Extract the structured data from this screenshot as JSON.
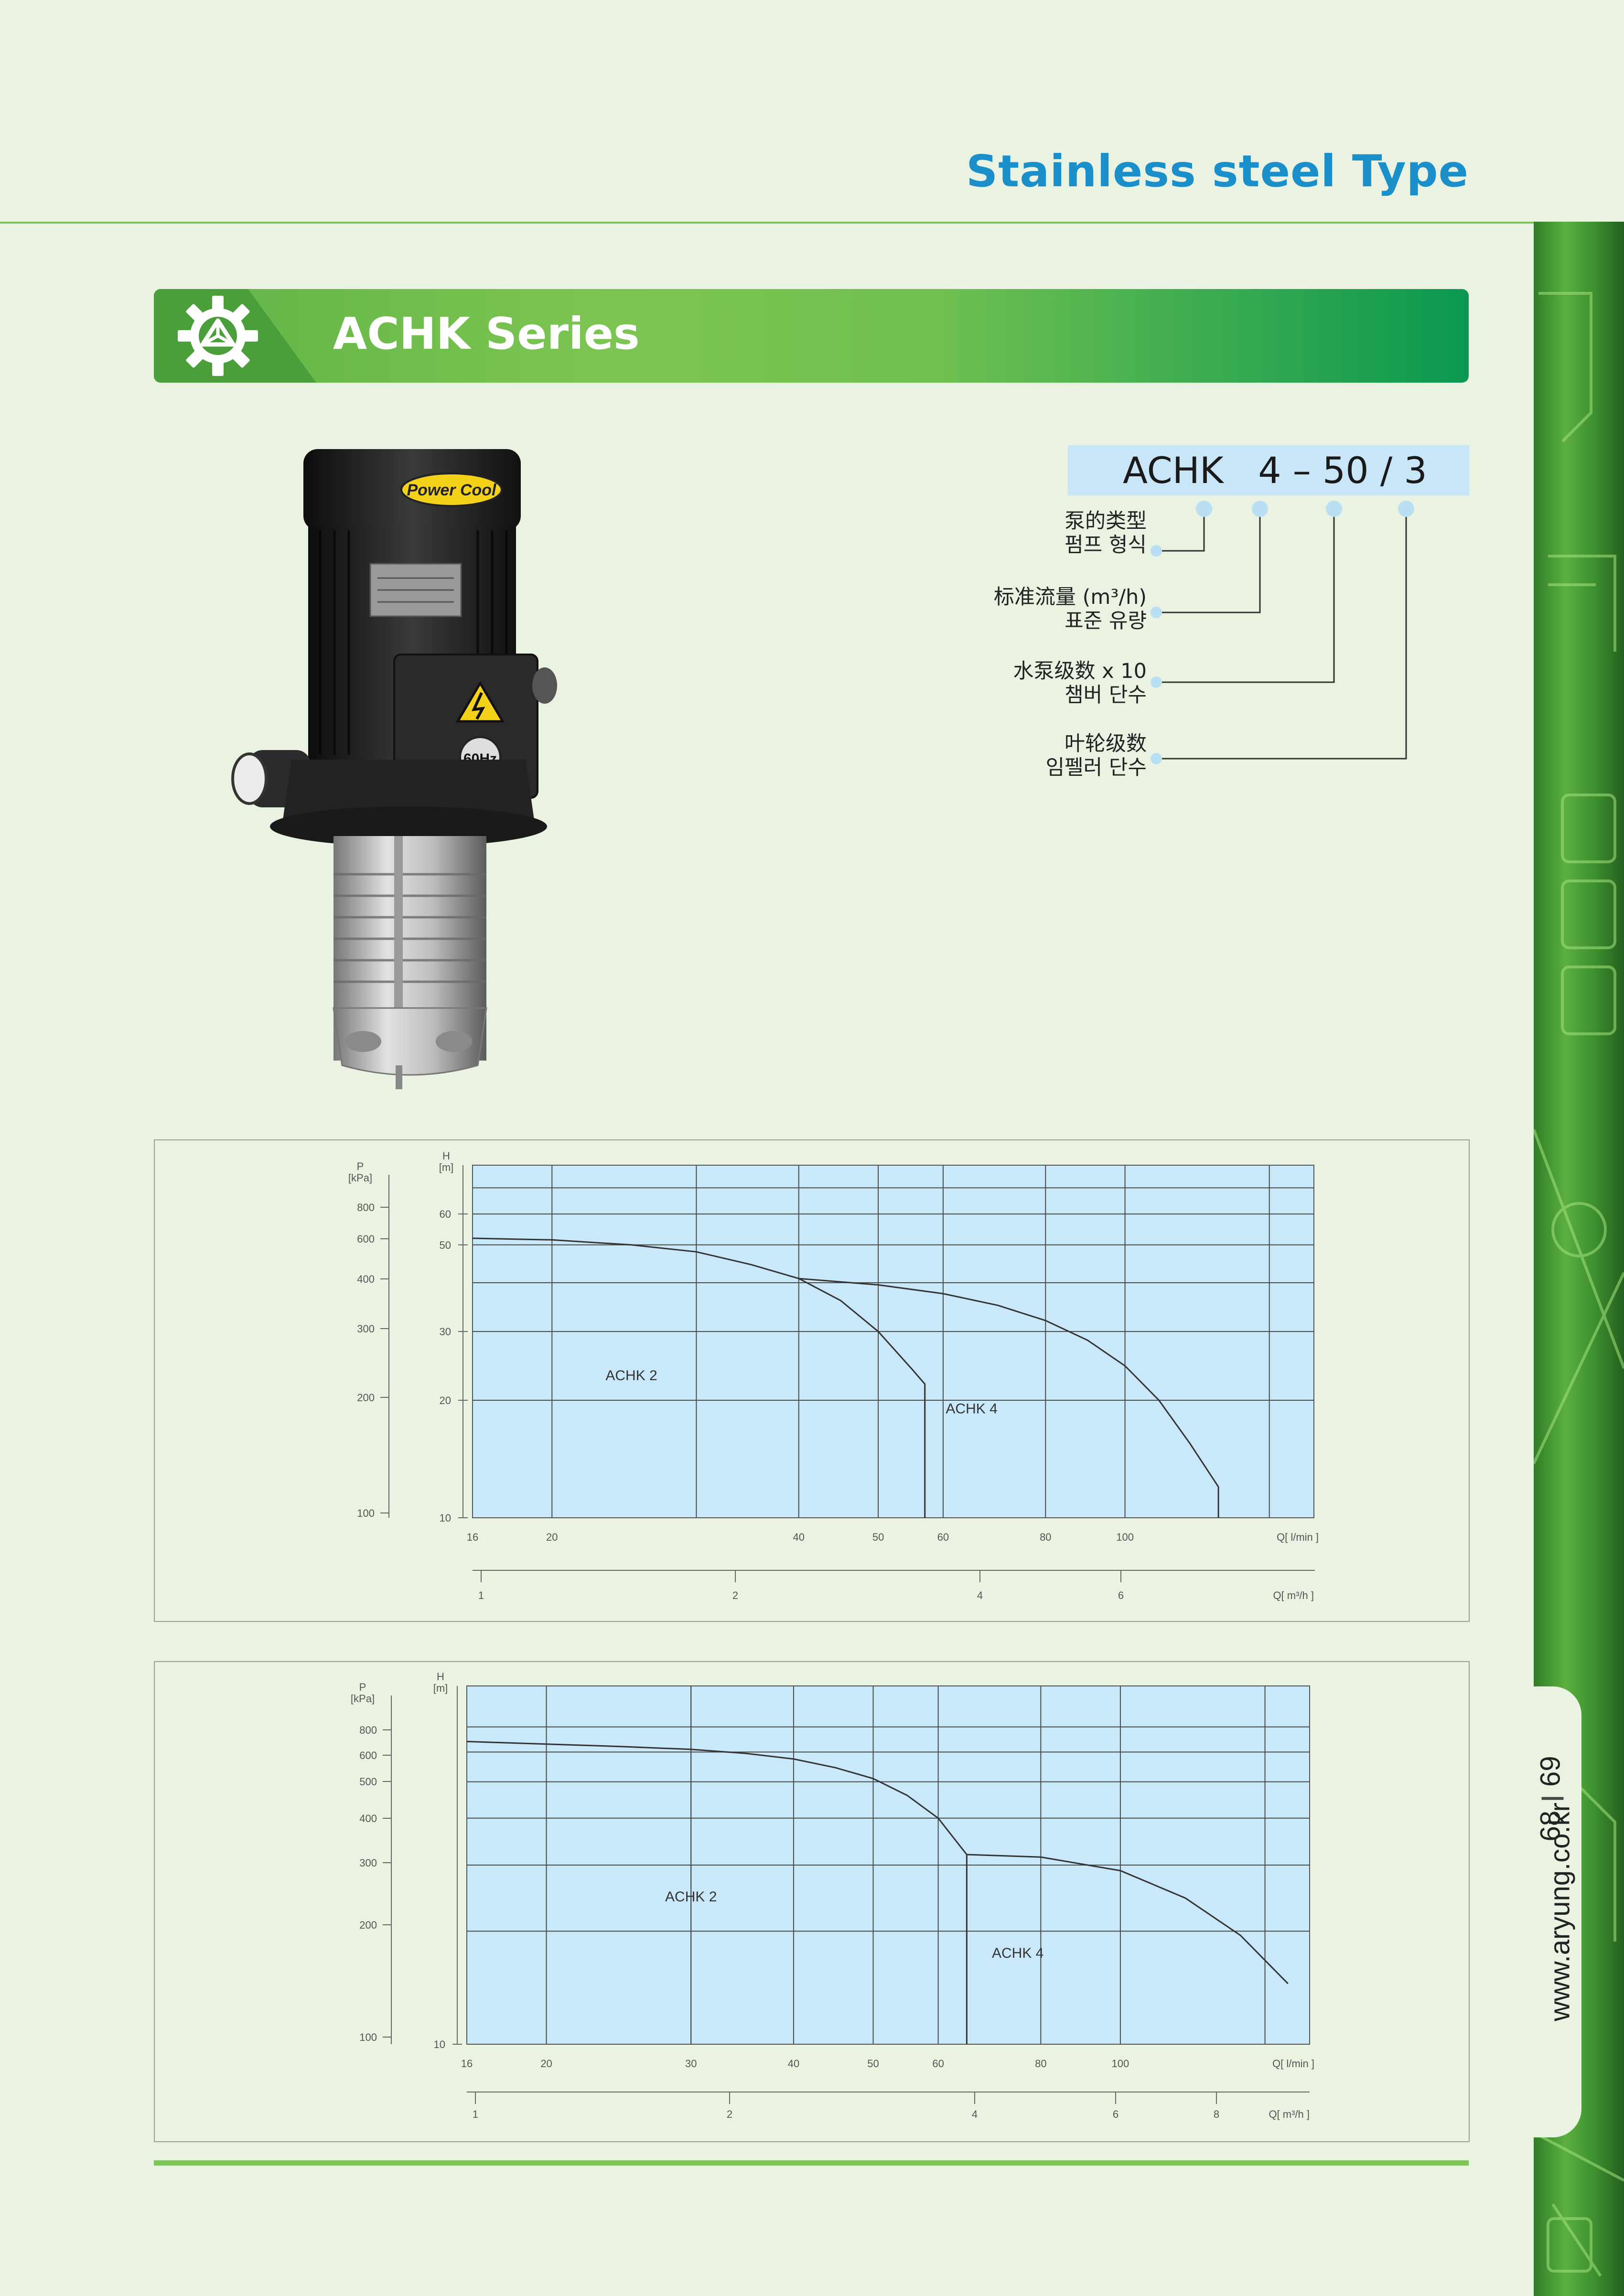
{
  "page": {
    "title": "Stainless steel Type",
    "url": "www.aryung.co.kr",
    "page_left": "68",
    "page_right": "69"
  },
  "series": {
    "title": "ACHK Series",
    "logo_icon": "gear-logo-icon"
  },
  "pump": {
    "brand_badge": "Power Cool",
    "freq_badge": "60Hz"
  },
  "model_code": {
    "prefix": "ACHK",
    "code": "4 – 50 / 3",
    "labels": [
      {
        "zh": "泵的类型",
        "ko": "펌프 형식"
      },
      {
        "zh": "标准流量 (m³/h)",
        "ko": "표준 유량"
      },
      {
        "zh": "水泵级数  x 10",
        "ko": "챔버 단수"
      },
      {
        "zh": "叶轮级数",
        "ko": "임펠러 단수"
      }
    ]
  },
  "colors": {
    "accent_blue": "#1b8fc9",
    "accent_green": "#7ec45a",
    "chart_fill": "#c9e8f9"
  },
  "chart_data": [
    {
      "type": "line",
      "p_axis": {
        "label": "P",
        "unit": "[kPa]",
        "ticks": [
          100,
          200,
          300,
          400,
          600,
          800
        ]
      },
      "h_axis": {
        "label": "H",
        "unit": "[m]",
        "ticks": [
          10,
          20,
          30,
          50,
          60
        ],
        "lim": [
          10,
          80
        ],
        "scale": "log"
      },
      "q_axis": {
        "label": "Q[ l/min ]",
        "ticks": [
          16,
          20,
          40,
          50,
          60,
          80,
          100
        ],
        "lim": [
          16,
          170
        ],
        "scale": "log"
      },
      "q2_axis": {
        "label": "Q[ m³/h ]",
        "ticks": [
          1,
          2,
          4,
          6
        ]
      },
      "series": [
        {
          "name": "ACHK 2",
          "x": [
            16,
            20,
            25,
            30,
            35,
            40,
            45,
            50,
            55,
            57,
            57
          ],
          "y": [
            52,
            51.5,
            50,
            48,
            44.5,
            41,
            36,
            30,
            24,
            22,
            10
          ]
        },
        {
          "name": "ACHK 4",
          "x": [
            40,
            50,
            60,
            70,
            80,
            90,
            100,
            110,
            120,
            130,
            130
          ],
          "y": [
            41,
            39.5,
            37.5,
            35,
            32,
            28.5,
            24.5,
            20,
            15.5,
            12,
            10
          ]
        }
      ],
      "grid": true
    },
    {
      "type": "line",
      "p_axis": {
        "label": "P",
        "unit": "[kPa]",
        "ticks": [
          100,
          200,
          300,
          400,
          500,
          600,
          800
        ]
      },
      "h_axis": {
        "label": "H",
        "unit": "[m]",
        "ticks": [
          10
        ],
        "lim": [
          10,
          90
        ],
        "scale": "log"
      },
      "q_axis": {
        "label": "Q[ l/min ]",
        "ticks": [
          16,
          20,
          30,
          40,
          50,
          60,
          80,
          100
        ],
        "lim": [
          16,
          170
        ],
        "scale": "log"
      },
      "q2_axis": {
        "label": "Q[ m³/h ]",
        "ticks": [
          1,
          2,
          4,
          6,
          8
        ]
      },
      "series": [
        {
          "name": "ACHK 2",
          "x": [
            16,
            20,
            25,
            30,
            35,
            40,
            45,
            50,
            55,
            60,
            65,
            65
          ],
          "y": [
            64,
            63,
            62,
            61,
            59.5,
            57.5,
            54.5,
            51,
            46,
            40,
            32,
            10
          ]
        },
        {
          "name": "ACHK 4",
          "x": [
            65,
            80,
            100,
            120,
            140,
            160
          ],
          "y": [
            32,
            31.5,
            29,
            24.5,
            19.5,
            14.5
          ]
        }
      ],
      "grid": true
    }
  ]
}
